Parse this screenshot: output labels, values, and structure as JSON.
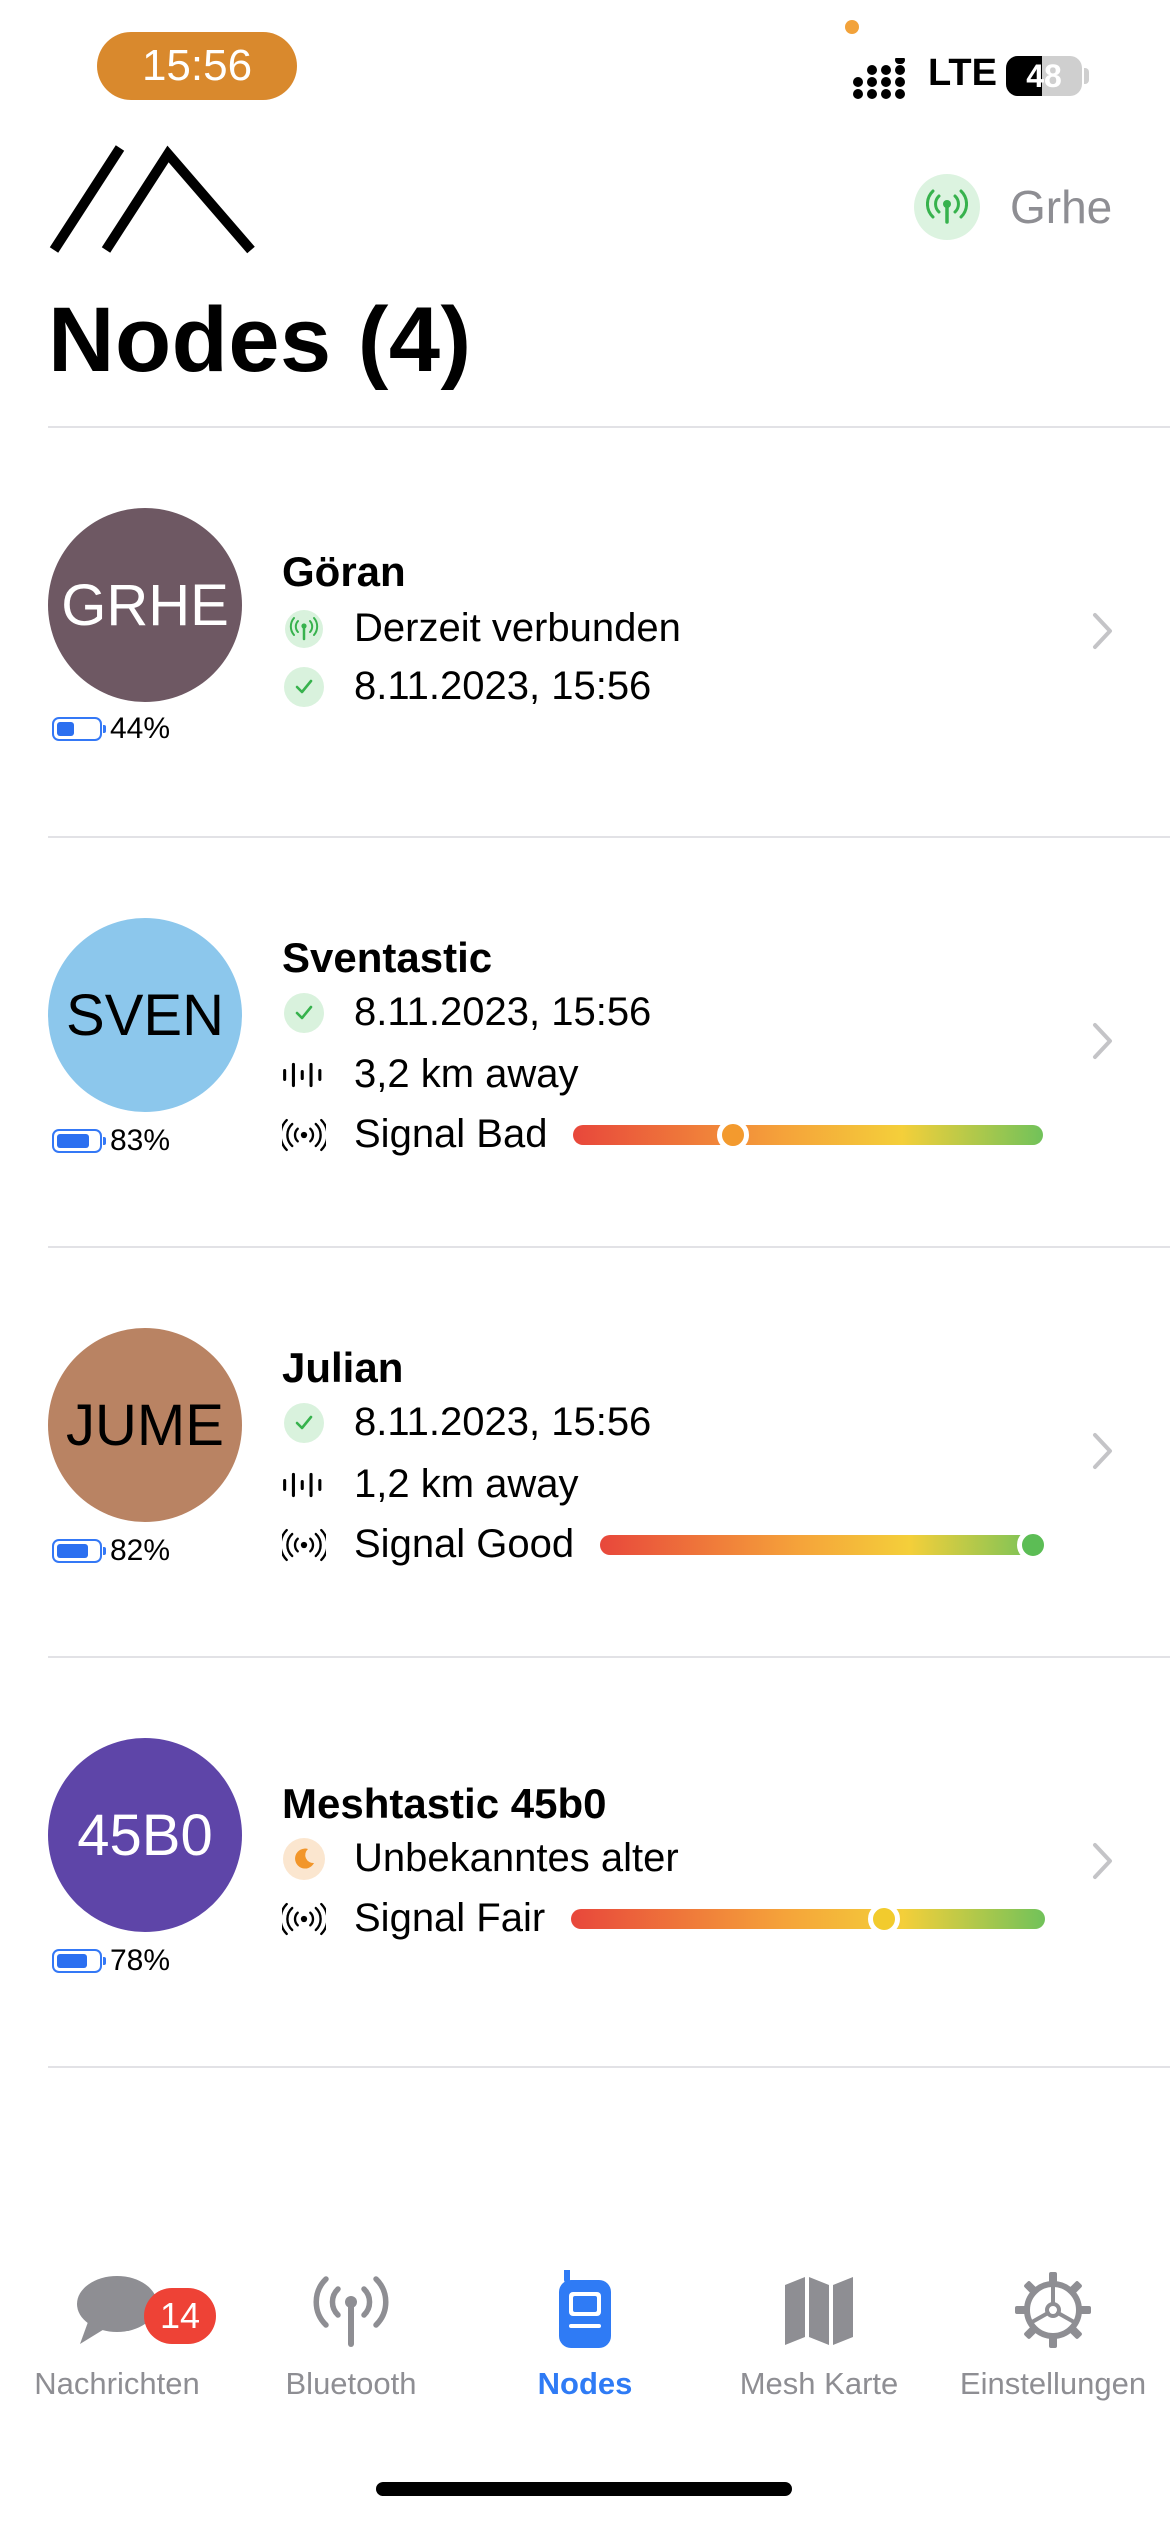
{
  "status_bar": {
    "time": "15:56",
    "network": "LTE",
    "battery": "48"
  },
  "header": {
    "connected_node": "Grhe",
    "title": "Nodes (4)"
  },
  "nodes": [
    {
      "short": "GRHE",
      "name": "Göran",
      "avatar_color": "#6e5863",
      "avatar_text_color": "#ffffff",
      "battery": "44%",
      "battery_level": 0.44,
      "status": "Derzeit verbunden",
      "last_heard": "8.11.2023, 15:56"
    },
    {
      "short": "SVEN",
      "name": "Sventastic",
      "avatar_color": "#8cc7ec",
      "avatar_text_color": "#000000",
      "battery": "83%",
      "battery_level": 0.83,
      "last_heard": "8.11.2023, 15:56",
      "distance": "3,2 km away",
      "signal": "Signal Bad",
      "signal_level": 0.34,
      "signal_dot_color": "#f39a2e"
    },
    {
      "short": "JUME",
      "name": "Julian",
      "avatar_color": "#b98363",
      "avatar_text_color": "#000000",
      "battery": "82%",
      "battery_level": 0.82,
      "last_heard": "8.11.2023, 15:56",
      "distance": "1,2 km away",
      "signal": "Signal Good",
      "signal_level": 0.98,
      "signal_dot_color": "#5cbd55"
    },
    {
      "short": "45B0",
      "name": "Meshtastic 45b0",
      "avatar_color": "#5e45a8",
      "avatar_text_color": "#ffffff",
      "battery": "78%",
      "battery_level": 0.78,
      "status": "Unbekanntes alter",
      "signal": "Signal Fair",
      "signal_level": 0.66,
      "signal_dot_color": "#f2cb2d"
    }
  ],
  "tabs": [
    {
      "label": "Nachrichten",
      "icon": "chat-bubble-icon",
      "badge": "14"
    },
    {
      "label": "Bluetooth",
      "icon": "antenna-icon"
    },
    {
      "label": "Nodes",
      "icon": "radio-device-icon",
      "active": true
    },
    {
      "label": "Mesh Karte",
      "icon": "map-icon"
    },
    {
      "label": "Einstellungen",
      "icon": "gear-icon"
    }
  ],
  "colors": {
    "accent": "#2f7bf5",
    "inactive": "#8e8e93",
    "badge": "#ee4236"
  }
}
